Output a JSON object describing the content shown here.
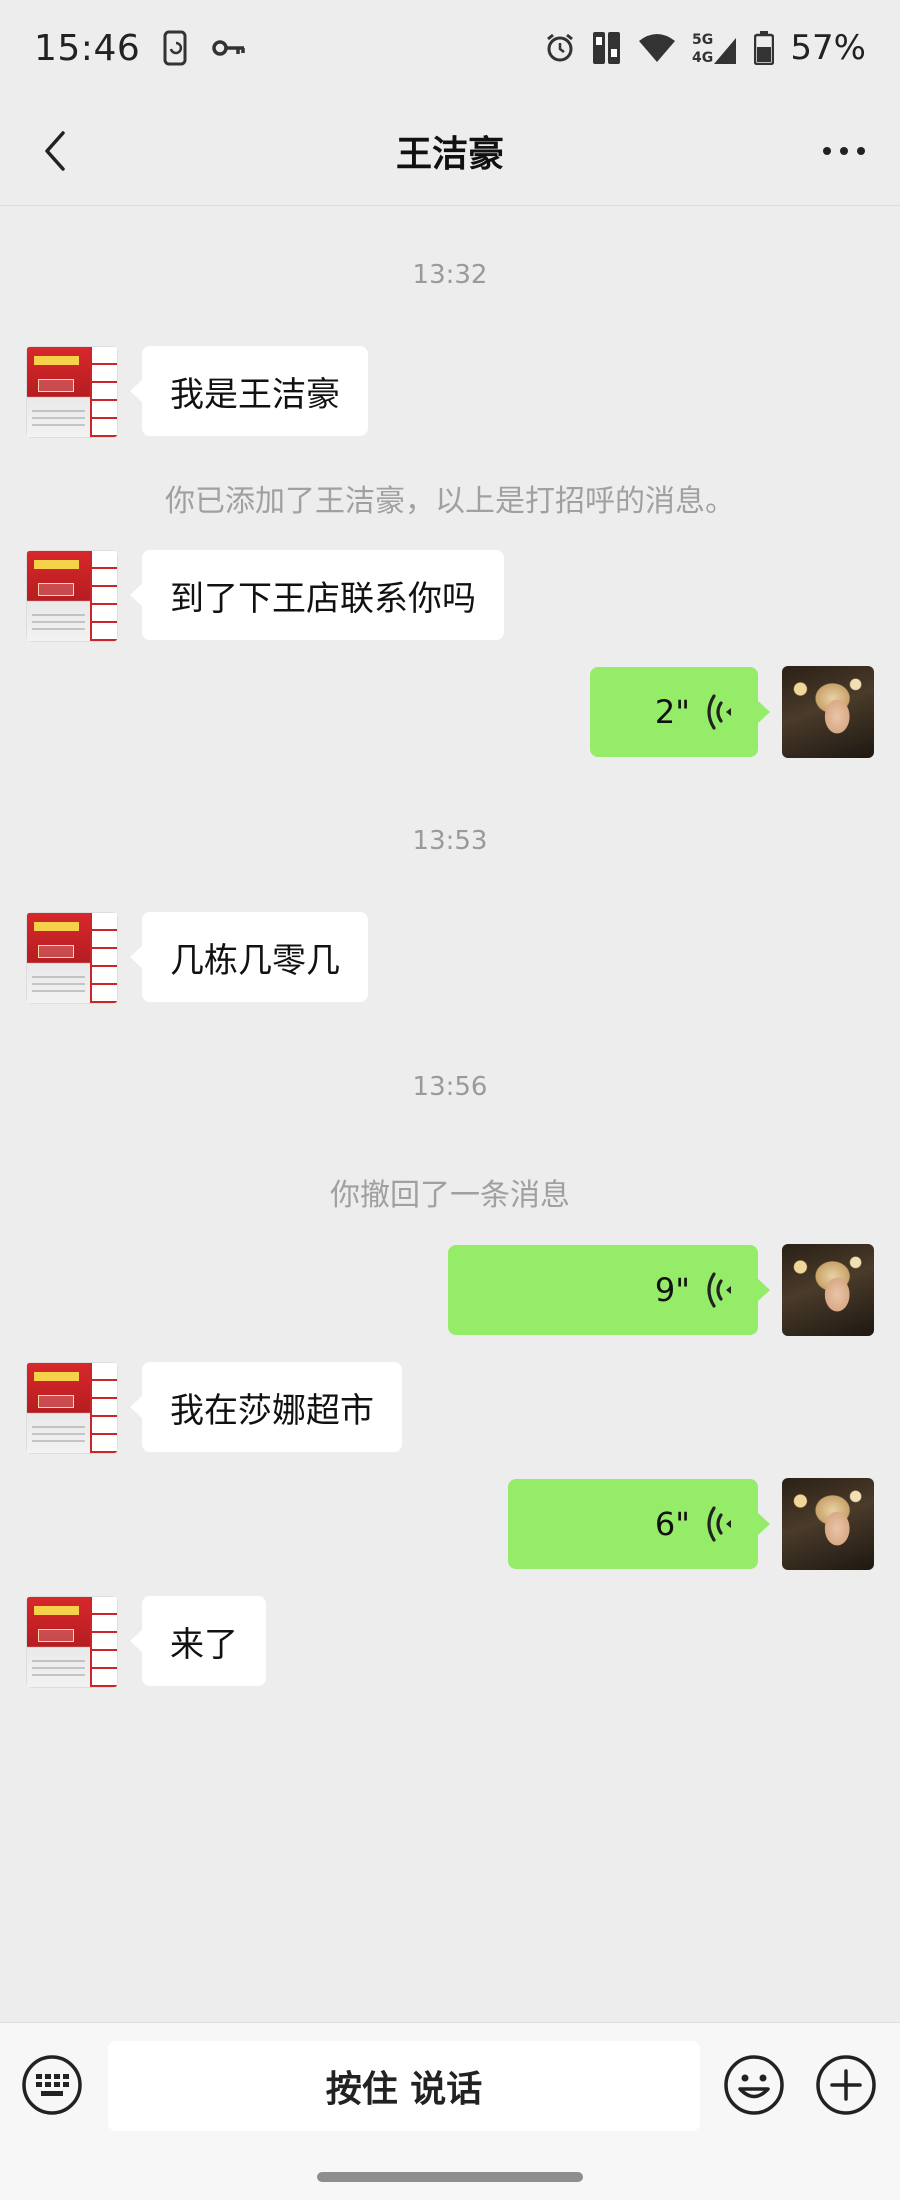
{
  "status_bar": {
    "time": "15:46",
    "network": "5G 4G",
    "battery": "57%"
  },
  "header": {
    "title": "王洁豪",
    "back_icon": "chevron-left-icon",
    "more_icon": "more-horizontal-icon"
  },
  "messages": {
    "ts1": "13:32",
    "m1": "我是王洁豪",
    "sys1": "你已添加了王洁豪，以上是打招呼的消息。",
    "m2": "到了下王店联系你吗",
    "v1": "2\"",
    "ts2": "13:53",
    "m3": "几栋几零几",
    "ts3": "13:56",
    "sys2": "你撤回了一条消息",
    "v2": "9\"",
    "m4": "我在莎娜超市",
    "v3": "6\"",
    "m5": "来了"
  },
  "voice_messages": [
    {
      "duration_seconds": 2,
      "sender": "self"
    },
    {
      "duration_seconds": 9,
      "sender": "self"
    },
    {
      "duration_seconds": 6,
      "sender": "self"
    }
  ],
  "bottom_bar": {
    "hold_to_talk": "按住 说话",
    "keyboard_icon": "keyboard-icon",
    "emoji_icon": "emoji-icon",
    "plus_icon": "plus-circle-icon"
  },
  "colors": {
    "background": "#ededed",
    "sent_bubble": "#95ec69",
    "received_bubble": "#ffffff"
  }
}
